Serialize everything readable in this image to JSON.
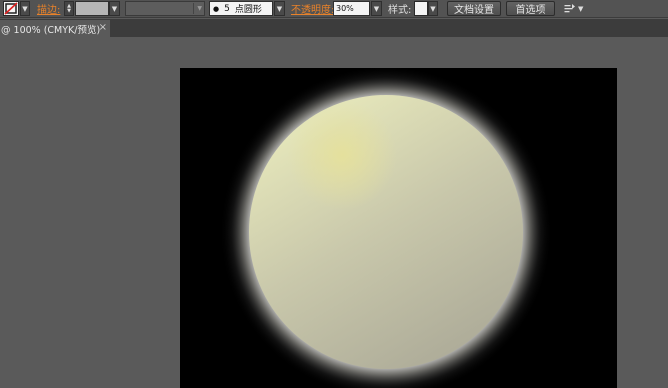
{
  "control_bar": {
    "stroke_label": "描边:",
    "brush": {
      "dot": "●",
      "size": "5",
      "shape": "点圆形"
    },
    "opacity_label": "不透明度:",
    "opacity_value": "30%",
    "style_label": "样式:",
    "doc_setup_label": "文档设置",
    "prefs_label": "首选项",
    "icons": {
      "stroke_swatch": "no-fill-swatch-icon",
      "arrange": "arrange-documents-icon"
    }
  },
  "tab": {
    "title": "@ 100% (CMYK/预览)",
    "close": "×"
  },
  "colors": {
    "accent_label": "#e8822a",
    "ui_dark": "#535353",
    "canvas_bg": "#5a5a5a",
    "artboard_bg": "#000000",
    "planet_light": "#e6e6b8",
    "planet_dark": "#a9a896",
    "glow": "#ffffff"
  }
}
